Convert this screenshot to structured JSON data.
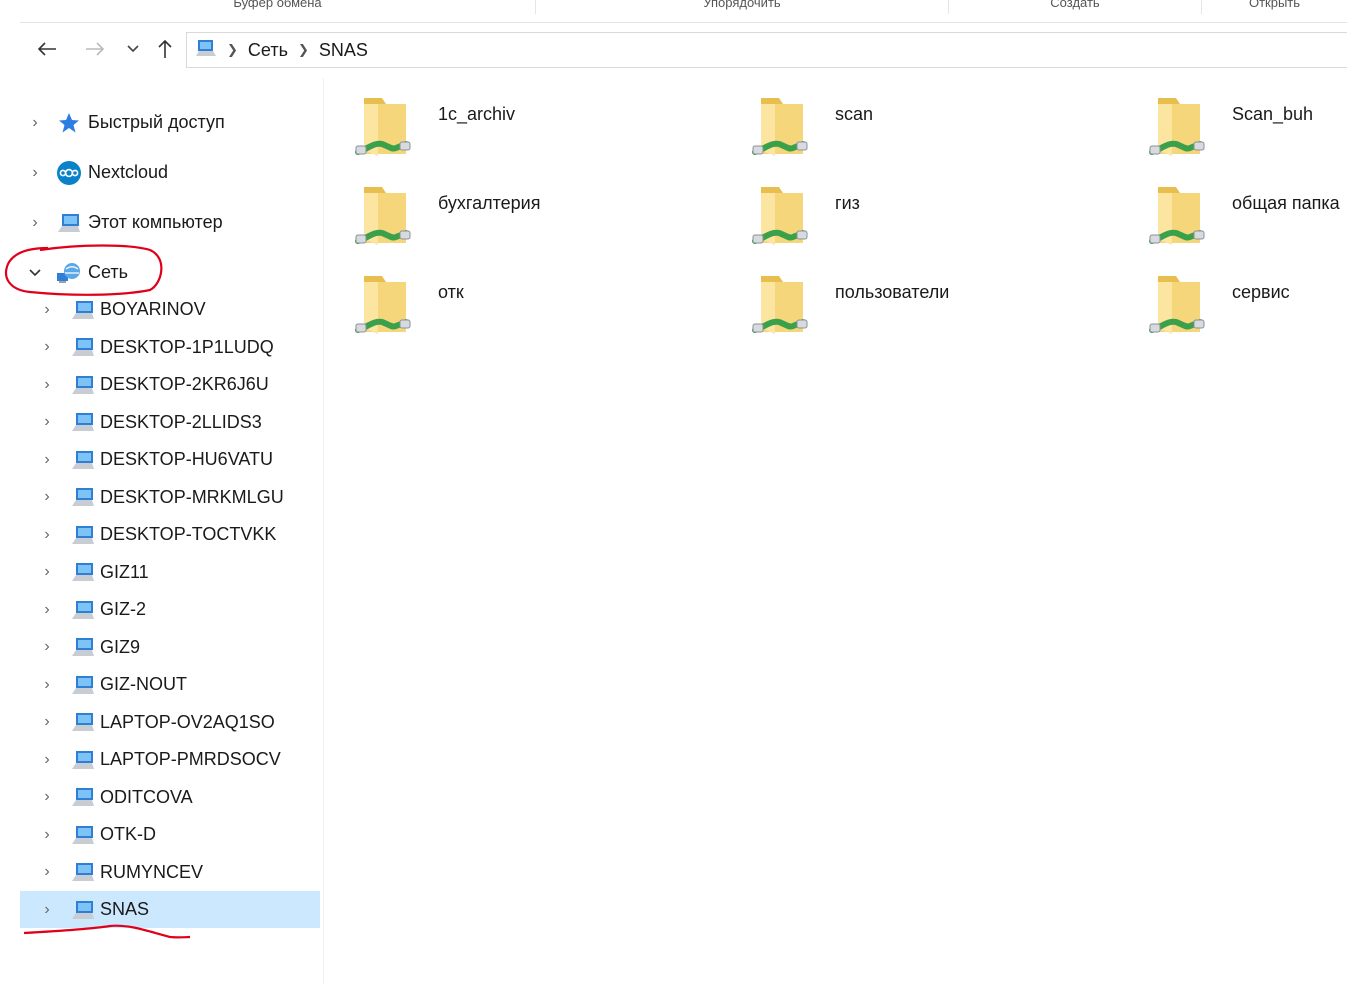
{
  "window": {
    "ribbon_groups": [
      "Буфер обмена",
      "Упорядочить",
      "Создать",
      "Открыть"
    ]
  },
  "toolbar": {
    "back_icon": "arrow-left-icon",
    "forward_icon": "arrow-right-icon",
    "recent_icon": "chevron-down-icon",
    "up_icon": "arrow-up-icon"
  },
  "address": {
    "crumbs": [
      "Сеть",
      "SNAS"
    ]
  },
  "sidebar": {
    "items": [
      {
        "label": "Быстрый доступ",
        "icon": "star-icon"
      },
      {
        "label": "Nextcloud",
        "icon": "nextcloud-icon"
      },
      {
        "label": "Этот компьютер",
        "icon": "computer-icon"
      },
      {
        "label": "Сеть",
        "icon": "network-icon"
      }
    ],
    "network_children": [
      "BOYARINOV",
      "DESKTOP-1P1LUDQ",
      "DESKTOP-2KR6J6U",
      "DESKTOP-2LLIDS3",
      "DESKTOP-HU6VATU",
      "DESKTOP-MRKMLGU",
      "DESKTOP-TOCTVKK",
      "GIZ11",
      "GIZ-2",
      "GIZ9",
      "GIZ-NOUT",
      "LAPTOP-OV2AQ1SO",
      "LAPTOP-PMRDSOCV",
      "ODITCOVA",
      "OTK-D",
      "RUMYNCEV",
      "SNAS"
    ],
    "selected": "SNAS"
  },
  "content": {
    "folders": [
      "1c_archiv",
      "scan",
      "Scan_buh",
      "бухгалтерия",
      "гиз",
      "общая папка",
      "отк",
      "пользователи",
      "сервис"
    ]
  },
  "colors": {
    "selection": "#cce8ff",
    "folder": "#f5d67a",
    "share": "#3aa14a",
    "annotation": "#e0001b"
  }
}
